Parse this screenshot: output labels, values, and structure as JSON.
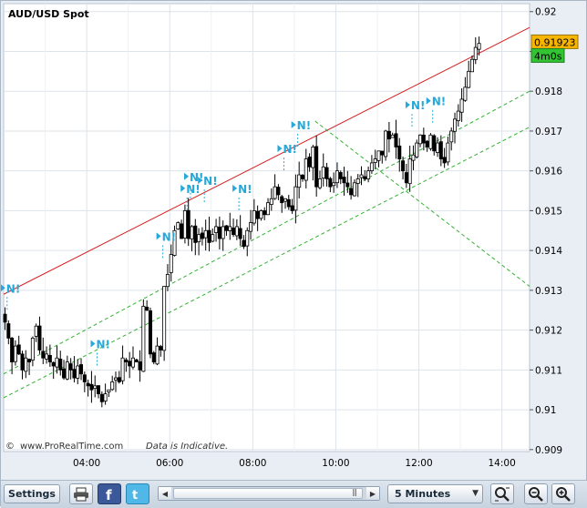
{
  "chart_title": "AUD/USD Spot",
  "credit": {
    "copyright": "©",
    "site": "www.ProRealTime.com",
    "note": "Data is Indicative."
  },
  "price_badge": {
    "price": "0.91923",
    "countdown": "4m0s"
  },
  "news_marker_label": "N!",
  "colors": {
    "background": "#e9eef4",
    "plot_bg": "#ffffff",
    "grid": "#dde3ea",
    "candle_up": "#ffffff",
    "candle_down": "#000000",
    "trendline": "#d62020",
    "channel": "#33b233",
    "news_marker": "#27a8d8",
    "price_badge_bg": "#f7b500",
    "countdown_bg": "#33c433"
  },
  "chart_data": {
    "type": "candlestick",
    "title": "AUD/USD Spot",
    "x_ticks": [
      "04:00",
      "06:00",
      "08:00",
      "10:00",
      "12:00",
      "14:00"
    ],
    "y_ticks": [
      "0.92",
      "0.919",
      "0.918",
      "0.917",
      "0.916",
      "0.915",
      "0.914",
      "0.913",
      "0.912",
      "0.911",
      "0.91",
      "0.909"
    ],
    "ylim": [
      0.90895,
      0.9202
    ],
    "xlim": [
      "02:00",
      "14:40"
    ],
    "bar_interval": "5 Minutes",
    "grid": true,
    "last_price": 0.91923,
    "news_markers": [
      "02:05",
      "04:15",
      "05:50",
      "06:25",
      "06:30",
      "06:50",
      "07:40",
      "08:45",
      "09:05",
      "11:50",
      "12:20"
    ],
    "trendlines": [
      {
        "style": "solid",
        "color": "red",
        "from": [
          "02:00",
          0.9129
        ],
        "to": [
          "14:40",
          0.9196
        ]
      },
      {
        "style": "dashed",
        "color": "green",
        "from": [
          "02:00",
          0.9109
        ],
        "to": [
          "14:40",
          0.918
        ]
      },
      {
        "style": "dashed",
        "color": "green",
        "from": [
          "02:00",
          0.9103
        ],
        "to": [
          "14:40",
          0.9171
        ]
      },
      {
        "style": "dashed",
        "color": "green",
        "from": [
          "09:30",
          0.91725
        ],
        "to": [
          "14:40",
          0.9131
        ]
      }
    ],
    "candles_close": [
      0.9122,
      0.9118,
      0.9112,
      0.9116,
      0.9114,
      0.911,
      0.9113,
      0.9112,
      0.9118,
      0.9121,
      0.9115,
      0.9113,
      0.9114,
      0.9112,
      0.9111,
      0.9113,
      0.911,
      0.9108,
      0.9112,
      0.911,
      0.9108,
      0.9111,
      0.9109,
      0.9107,
      0.9106,
      0.9105,
      0.9106,
      0.9104,
      0.9102,
      0.9104,
      0.9105,
      0.9107,
      0.9108,
      0.9107,
      0.9113,
      0.9112,
      0.9111,
      0.9113,
      0.9112,
      0.911,
      0.9126,
      0.9125,
      0.9114,
      0.9112,
      0.9116,
      0.9115,
      0.9131,
      0.9134,
      0.9139,
      0.9145,
      0.9147,
      0.9143,
      0.915,
      0.9143,
      0.9146,
      0.9142,
      0.9144,
      0.9143,
      0.9145,
      0.9142,
      0.9144,
      0.9146,
      0.9143,
      0.9146,
      0.9145,
      0.9146,
      0.9144,
      0.9146,
      0.9143,
      0.9141,
      0.9145,
      0.9147,
      0.915,
      0.9148,
      0.915,
      0.9149,
      0.9152,
      0.9153,
      0.9156,
      0.9154,
      0.9152,
      0.9153,
      0.9151,
      0.915,
      0.9156,
      0.9159,
      0.9158,
      0.9163,
      0.9161,
      0.9166,
      0.9156,
      0.9158,
      0.9161,
      0.9158,
      0.9156,
      0.9157,
      0.916,
      0.9158,
      0.9157,
      0.9156,
      0.9154,
      0.9157,
      0.9158,
      0.9159,
      0.9158,
      0.916,
      0.9162,
      0.9163,
      0.9165,
      0.9164,
      0.917,
      0.9168,
      0.9169,
      0.9166,
      0.9163,
      0.916,
      0.9157,
      0.9163,
      0.9164,
      0.9167,
      0.9169,
      0.9167,
      0.9166,
      0.9169,
      0.9165,
      0.9167,
      0.9163,
      0.9162,
      0.9167,
      0.917,
      0.9173,
      0.9175,
      0.9178,
      0.9181,
      0.9185,
      0.9188,
      0.9191,
      0.9192
    ]
  },
  "toolbar": {
    "settings_label": "Settings",
    "timeframe_selected": "5 Minutes",
    "grip": "|||"
  }
}
